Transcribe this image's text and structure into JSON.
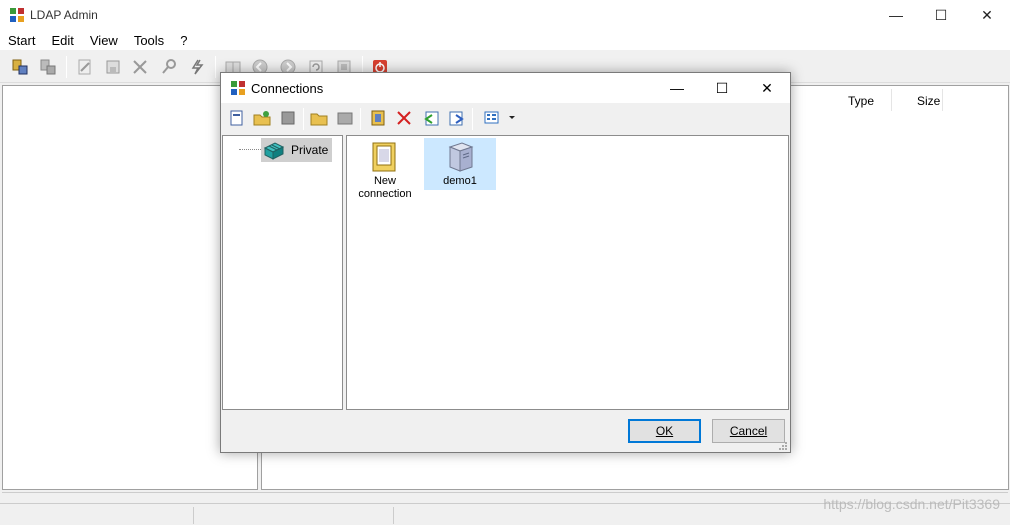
{
  "window": {
    "title": "LDAP Admin",
    "controls": {
      "minimize": "—",
      "maximize": "☐",
      "close": "✕"
    }
  },
  "menu": [
    "Start",
    "Edit",
    "View",
    "Tools",
    "?"
  ],
  "list_columns": [
    "Type",
    "Size"
  ],
  "dialog": {
    "title": "Connections",
    "controls": {
      "minimize": "—",
      "maximize": "☐",
      "close": "✕"
    },
    "tree": {
      "node_label": "Private"
    },
    "items": [
      {
        "label_line1": "New",
        "label_line2": "connection"
      },
      {
        "label_line1": "demo1",
        "label_line2": ""
      }
    ],
    "buttons": {
      "ok": "OK",
      "cancel": "Cancel"
    }
  },
  "watermark": "https://blog.csdn.net/Pit3369",
  "colors": {
    "selection": "#cce8ff",
    "default_button_border": "#0078d7",
    "delete_red": "#d42020"
  }
}
